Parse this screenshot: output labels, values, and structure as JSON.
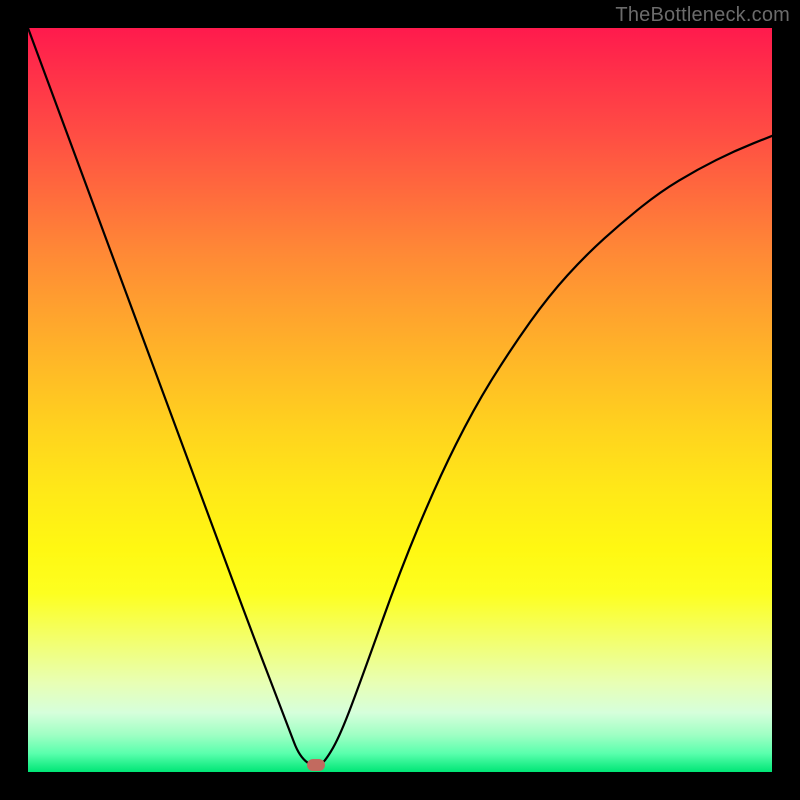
{
  "watermark": "TheBottleneck.com",
  "marker": {
    "color": "#c26a5f",
    "x_frac": 0.387,
    "y_frac": 0.991
  },
  "chart_data": {
    "type": "line",
    "title": "",
    "xlabel": "",
    "ylabel": "",
    "xlim": [
      0,
      100
    ],
    "ylim": [
      0,
      100
    ],
    "grid": false,
    "legend": false,
    "annotations": [],
    "series": [
      {
        "name": "curve",
        "x": [
          0,
          5,
          10,
          15,
          20,
          25,
          30,
          35,
          36.5,
          38.7,
          40,
          42,
          45,
          50,
          55,
          60,
          65,
          70,
          75,
          80,
          85,
          90,
          95,
          100
        ],
        "y": [
          100,
          86.5,
          73,
          59.5,
          46,
          32.5,
          19,
          6,
          2,
          0.5,
          1.5,
          5,
          13,
          27,
          39,
          49,
          57,
          64,
          69.5,
          74,
          78,
          81,
          83.5,
          85.5
        ]
      }
    ],
    "background_gradient": {
      "orientation": "vertical",
      "stops": [
        {
          "pos": 0.0,
          "color": "#ff1a4d"
        },
        {
          "pos": 0.3,
          "color": "#ff8836"
        },
        {
          "pos": 0.6,
          "color": "#ffe818"
        },
        {
          "pos": 0.88,
          "color": "#e8ffb4"
        },
        {
          "pos": 1.0,
          "color": "#00e676"
        }
      ]
    },
    "marker_point": {
      "x": 38.7,
      "y": 0.9,
      "color": "#c26a5f"
    }
  }
}
